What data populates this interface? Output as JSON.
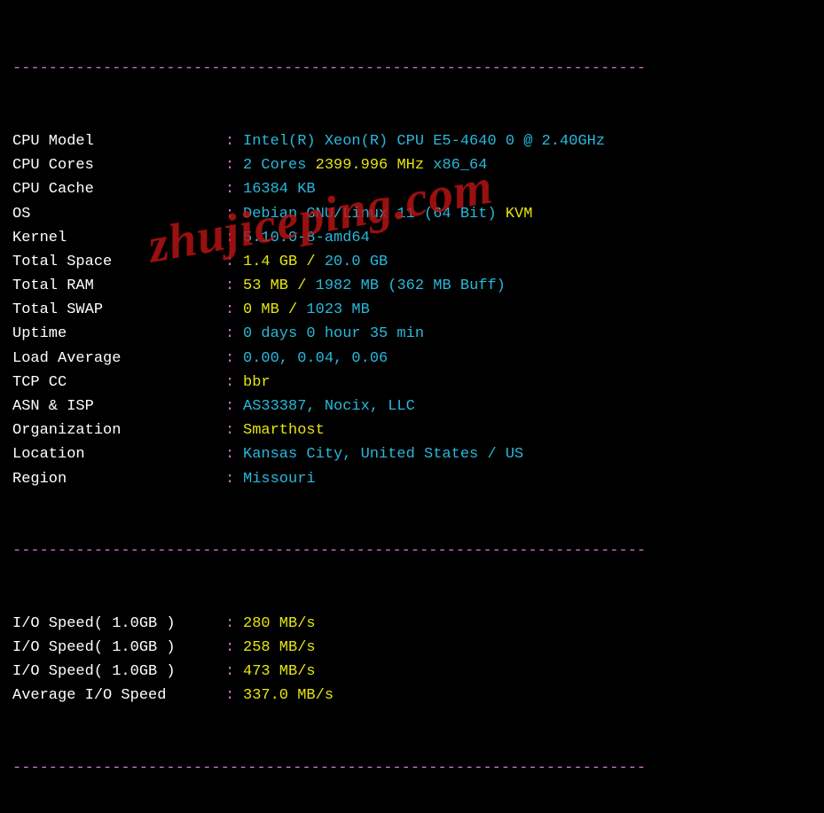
{
  "watermark": "zhujiceping.com",
  "divider": "----------------------------------------------------------------------",
  "rows_sys": [
    {
      "label": "CPU Model",
      "value_parts": [
        {
          "text": "Intel(R) Xeon(R) CPU E5-4640 0 @ 2.40GHz",
          "cls": "cyan"
        }
      ]
    },
    {
      "label": "CPU Cores",
      "value_parts": [
        {
          "text": "2 Cores ",
          "cls": "cyan"
        },
        {
          "text": "2399.996 MHz ",
          "cls": "yellow"
        },
        {
          "text": "x86_64",
          "cls": "cyan"
        }
      ]
    },
    {
      "label": "CPU Cache",
      "value_parts": [
        {
          "text": "16384 KB",
          "cls": "cyan"
        }
      ]
    },
    {
      "label": "OS",
      "value_parts": [
        {
          "text": "Debian GNU/Linux 11 (64 Bit) ",
          "cls": "cyan"
        },
        {
          "text": "KVM",
          "cls": "yellow"
        }
      ]
    },
    {
      "label": "Kernel",
      "value_parts": [
        {
          "text": "5.10.0-8-amd64",
          "cls": "cyan"
        }
      ]
    },
    {
      "label": "Total Space",
      "value_parts": [
        {
          "text": "1.4 GB / ",
          "cls": "yellow"
        },
        {
          "text": "20.0 GB",
          "cls": "cyan"
        }
      ]
    },
    {
      "label": "Total RAM",
      "value_parts": [
        {
          "text": "53 MB / ",
          "cls": "yellow"
        },
        {
          "text": "1982 MB ",
          "cls": "cyan"
        },
        {
          "text": "(362 MB Buff)",
          "cls": "cyan"
        }
      ]
    },
    {
      "label": "Total SWAP",
      "value_parts": [
        {
          "text": "0 MB / ",
          "cls": "yellow"
        },
        {
          "text": "1023 MB",
          "cls": "cyan"
        }
      ]
    },
    {
      "label": "Uptime",
      "value_parts": [
        {
          "text": "0 days 0 hour 35 min",
          "cls": "cyan"
        }
      ]
    },
    {
      "label": "Load Average",
      "value_parts": [
        {
          "text": "0.00, 0.04, 0.06",
          "cls": "cyan"
        }
      ]
    },
    {
      "label": "TCP CC",
      "value_parts": [
        {
          "text": "bbr",
          "cls": "yellow"
        }
      ]
    },
    {
      "label": "ASN & ISP",
      "value_parts": [
        {
          "text": "AS33387, Nocix, LLC",
          "cls": "cyan"
        }
      ]
    },
    {
      "label": "Organization",
      "value_parts": [
        {
          "text": "Smarthost",
          "cls": "yellow"
        }
      ]
    },
    {
      "label": "Location",
      "value_parts": [
        {
          "text": "Kansas City, United States / US",
          "cls": "cyan"
        }
      ]
    },
    {
      "label": "Region",
      "value_parts": [
        {
          "text": "Missouri",
          "cls": "cyan"
        }
      ]
    }
  ],
  "rows_io": [
    {
      "label": "I/O Speed( 1.0GB )",
      "value_parts": [
        {
          "text": "280 MB/s",
          "cls": "yellow"
        }
      ]
    },
    {
      "label": "I/O Speed( 1.0GB )",
      "value_parts": [
        {
          "text": "258 MB/s",
          "cls": "yellow"
        }
      ]
    },
    {
      "label": "I/O Speed( 1.0GB )",
      "value_parts": [
        {
          "text": "473 MB/s",
          "cls": "yellow"
        }
      ]
    },
    {
      "label": "Average I/O Speed",
      "value_parts": [
        {
          "text": "337.0 MB/s",
          "cls": "yellow"
        }
      ]
    }
  ]
}
